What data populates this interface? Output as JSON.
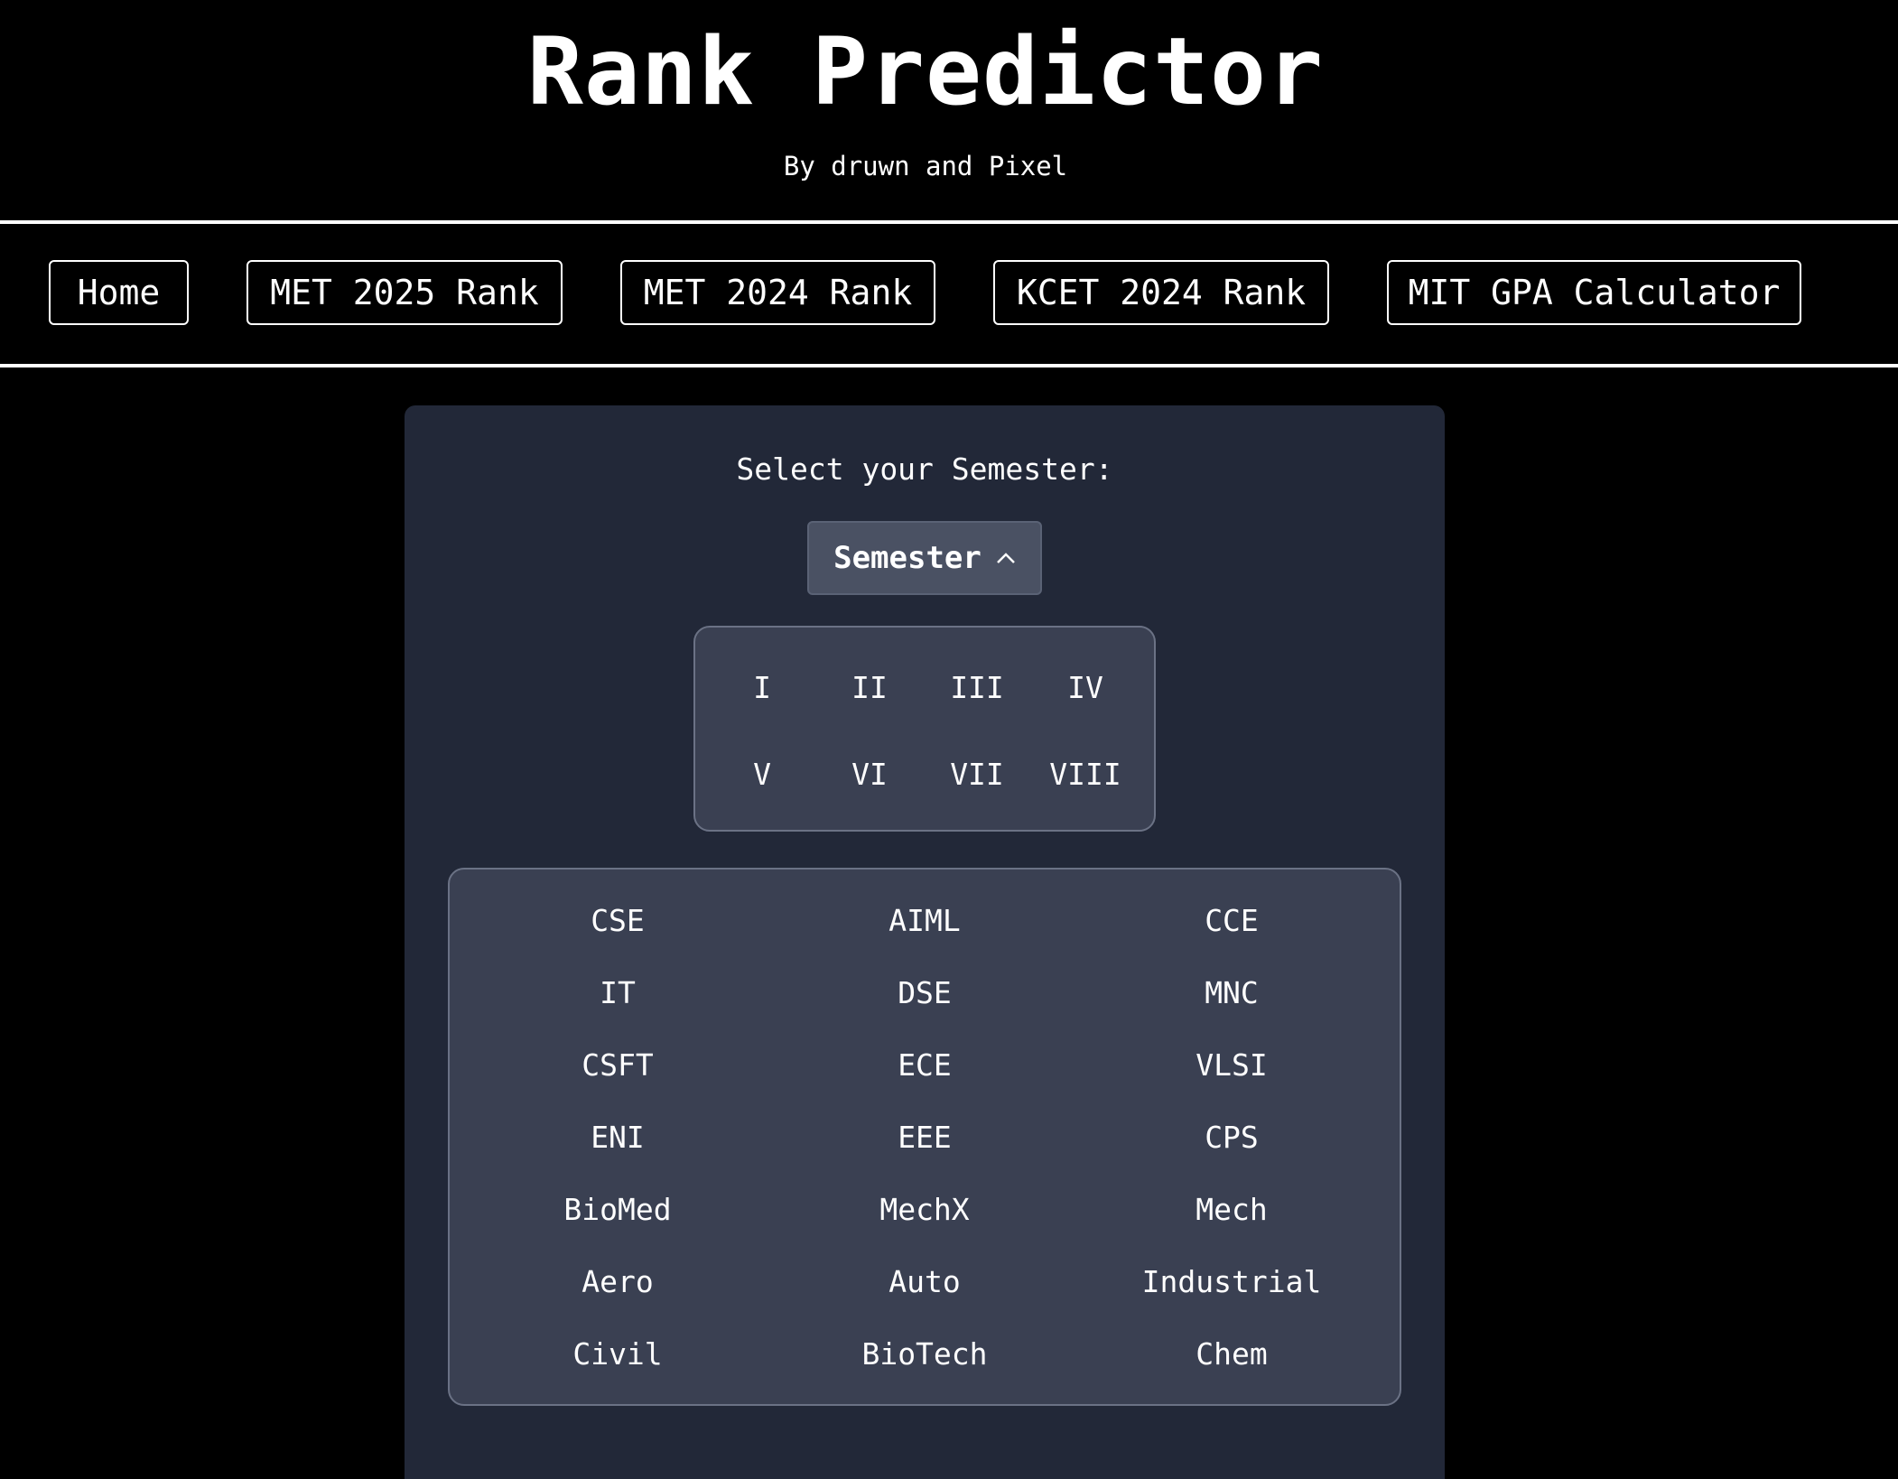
{
  "header": {
    "title": "Rank Predictor",
    "subtitle": "By druwn and Pixel"
  },
  "nav": {
    "items": [
      {
        "label": "Home"
      },
      {
        "label": "MET 2025 Rank"
      },
      {
        "label": "MET 2024 Rank"
      },
      {
        "label": "KCET 2024 Rank"
      },
      {
        "label": "MIT GPA Calculator"
      }
    ]
  },
  "main": {
    "select_label": "Select your Semester:",
    "semester_button": "Semester",
    "semester_button_icon": "chevron-up-icon",
    "semesters": [
      "I",
      "II",
      "III",
      "IV",
      "V",
      "VI",
      "VII",
      "VIII"
    ],
    "branches": [
      "CSE",
      "AIML",
      "CCE",
      "IT",
      "DSE",
      "MNC",
      "CSFT",
      "ECE",
      "VLSI",
      "ENI",
      "EEE",
      "CPS",
      "BioMed",
      "MechX",
      "Mech",
      "Aero",
      "Auto",
      "Industrial",
      "Civil",
      "BioTech",
      "Chem"
    ]
  },
  "colors": {
    "page_background": "#000000",
    "panel_background": "#222838",
    "dropdown_background": "#3a4052",
    "button_background": "#4a5163",
    "border": "#6b7285",
    "text": "#ffffff"
  }
}
